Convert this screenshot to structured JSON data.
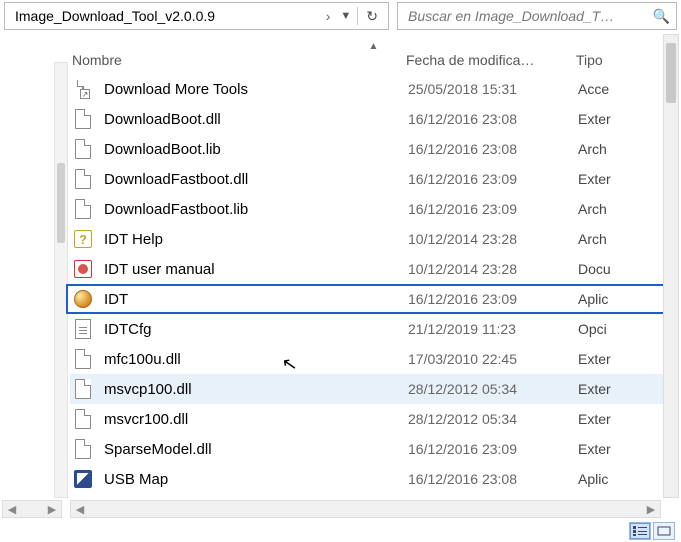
{
  "toolbar": {
    "breadcrumb": "Image_Download_Tool_v2.0.0.9",
    "breadcrumb_sep": "›",
    "search_placeholder": "Buscar en Image_Download_T…"
  },
  "columns": {
    "name": "Nombre",
    "date": "Fecha de modifica…",
    "type": "Tipo"
  },
  "rows": [
    {
      "icon": "shortcut",
      "name": "Download More Tools",
      "date": "25/05/2018 15:31",
      "type": "Acce"
    },
    {
      "icon": "page",
      "name": "DownloadBoot.dll",
      "date": "16/12/2016 23:08",
      "type": "Exter"
    },
    {
      "icon": "page",
      "name": "DownloadBoot.lib",
      "date": "16/12/2016 23:08",
      "type": "Arch"
    },
    {
      "icon": "page",
      "name": "DownloadFastboot.dll",
      "date": "16/12/2016 23:09",
      "type": "Exter"
    },
    {
      "icon": "page",
      "name": "DownloadFastboot.lib",
      "date": "16/12/2016 23:09",
      "type": "Arch"
    },
    {
      "icon": "help",
      "name": "IDT Help",
      "date": "10/12/2014 23:28",
      "type": "Arch"
    },
    {
      "icon": "pdf",
      "name": "IDT user manual",
      "date": "10/12/2014 23:28",
      "type": "Docu"
    },
    {
      "icon": "app",
      "name": "IDT",
      "date": "16/12/2016 23:09",
      "type": "Aplic",
      "highlight": true
    },
    {
      "icon": "ini",
      "name": "IDTCfg",
      "date": "21/12/2019 11:23",
      "type": "Opci"
    },
    {
      "icon": "page",
      "name": "mfc100u.dll",
      "date": "17/03/2010 22:45",
      "type": "Exter",
      "cursor": true
    },
    {
      "icon": "page",
      "name": "msvcp100.dll",
      "date": "28/12/2012 05:34",
      "type": "Exter",
      "hover": true
    },
    {
      "icon": "page",
      "name": "msvcr100.dll",
      "date": "28/12/2012 05:34",
      "type": "Exter"
    },
    {
      "icon": "page",
      "name": "SparseModel.dll",
      "date": "16/12/2016 23:09",
      "type": "Exter"
    },
    {
      "icon": "usb",
      "name": "USB Map",
      "date": "16/12/2016 23:08",
      "type": "Aplic"
    }
  ]
}
